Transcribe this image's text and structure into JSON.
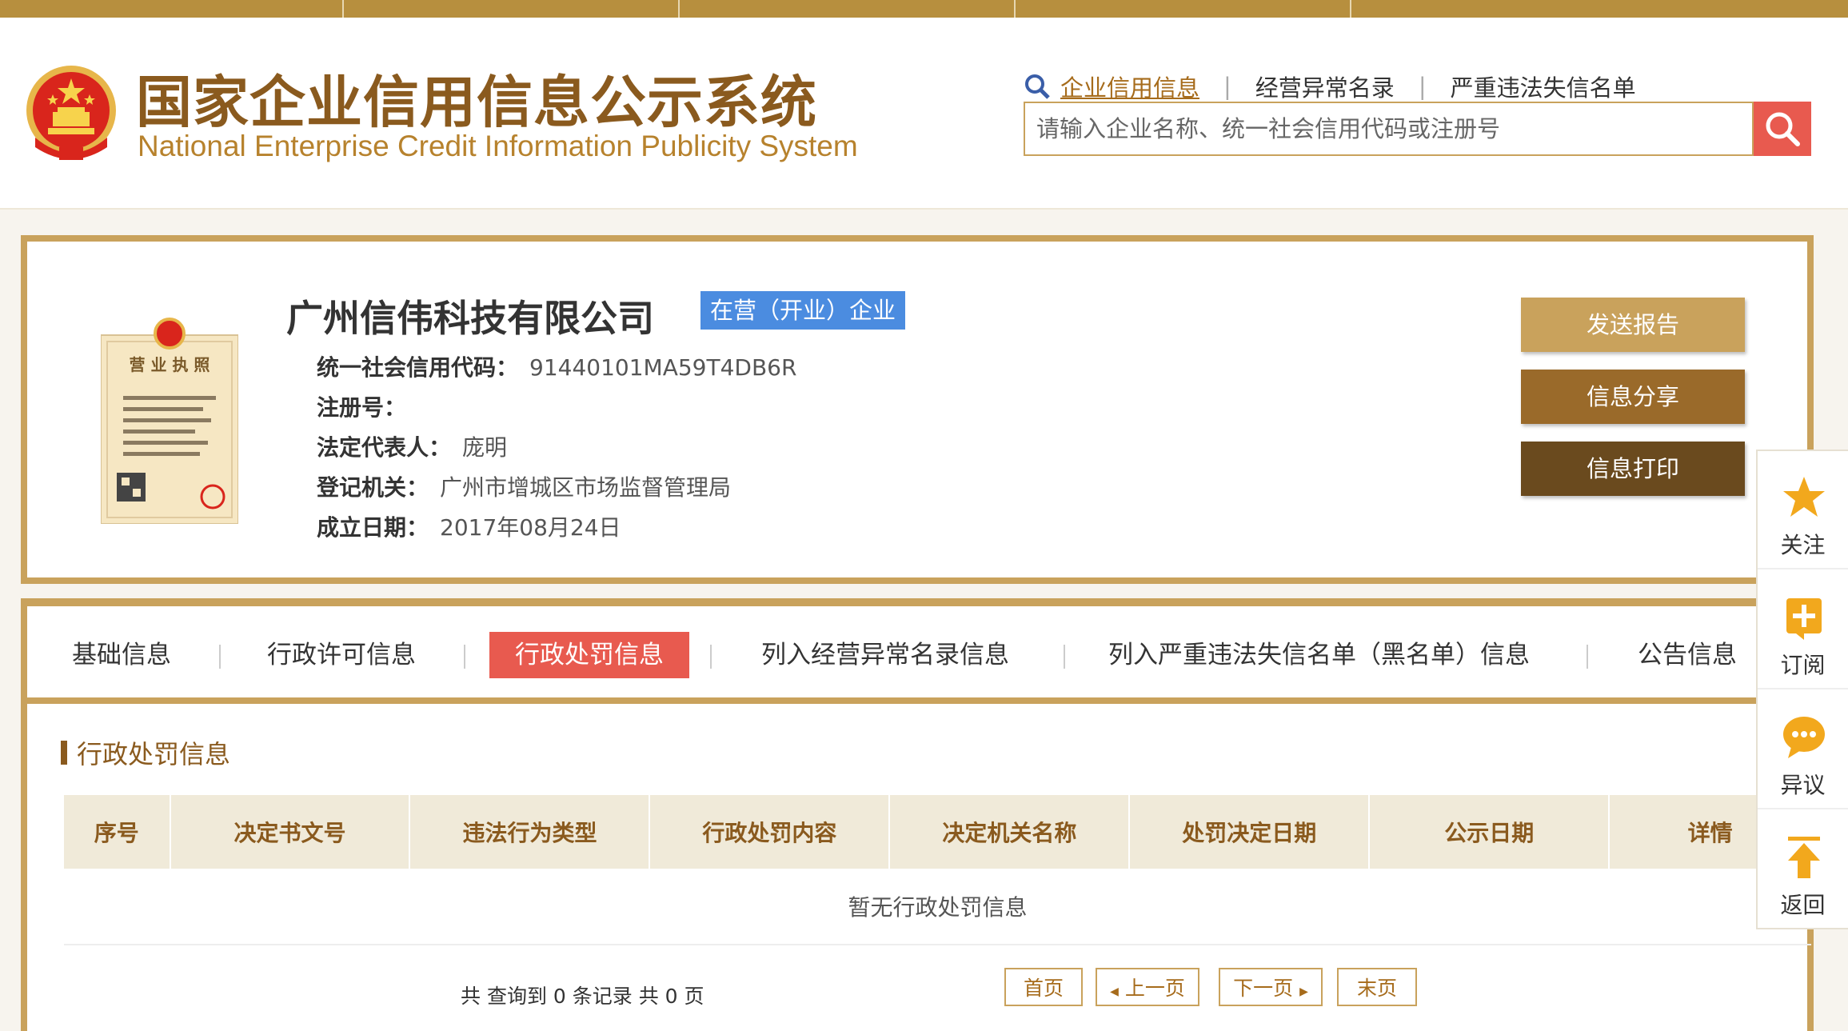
{
  "header": {
    "title_cn": "国家企业信用信息公示系统",
    "title_en": "National Enterprise Credit Information Publicity System",
    "nav": [
      {
        "label": "企业信用信息"
      },
      {
        "label": "经营异常名录"
      },
      {
        "label": "严重违法失信名单"
      }
    ],
    "search_placeholder": "请输入企业名称、统一社会信用代码或注册号"
  },
  "company": {
    "name": "广州信伟科技有限公司",
    "status": "在营（开业）企业",
    "license_text": "营 业 执 照",
    "fields": [
      {
        "label": "统一社会信用代码：",
        "value": "91440101MA59T4DB6R"
      },
      {
        "label": "注册号：",
        "value": ""
      },
      {
        "label": "法定代表人：",
        "value": "庞明"
      },
      {
        "label": "登记机关：",
        "value": "广州市增城区市场监督管理局"
      },
      {
        "label": "成立日期：",
        "value": "2017年08月24日"
      }
    ]
  },
  "actions": [
    {
      "label": "发送报告",
      "color": "#c9a25c"
    },
    {
      "label": "信息分享",
      "color": "#9a6a2a"
    },
    {
      "label": "信息打印",
      "color": "#6a4a1e"
    }
  ],
  "tabs": [
    {
      "label": "基础信息"
    },
    {
      "label": "行政许可信息"
    },
    {
      "label": "行政处罚信息"
    },
    {
      "label": "列入经营异常名录信息"
    },
    {
      "label": "列入严重违法失信名单（黑名单）信息"
    },
    {
      "label": "公告信息"
    }
  ],
  "section": {
    "title": "行政处罚信息",
    "columns": [
      "序号",
      "决定书文号",
      "违法行为类型",
      "行政处罚内容",
      "决定机关名称",
      "处罚决定日期",
      "公示日期",
      "详情"
    ],
    "empty_text": "暂无行政处罚信息"
  },
  "pagination": {
    "summary": "共 查询到 0 条记录 共 0 页",
    "first": "首页",
    "prev": "上一页",
    "next": "下一页",
    "last": "末页"
  },
  "sidebar": [
    {
      "label": "关注",
      "icon": "star-icon"
    },
    {
      "label": "订阅",
      "icon": "plus-icon"
    },
    {
      "label": "异议",
      "icon": "chat-icon"
    },
    {
      "label": "返回",
      "icon": "arrow-up-icon"
    }
  ],
  "colors": {
    "gold": "#c9a25c",
    "brown": "#8a5a1e",
    "accent_red": "#e85a4f",
    "badge_blue": "#4b8ce0"
  }
}
